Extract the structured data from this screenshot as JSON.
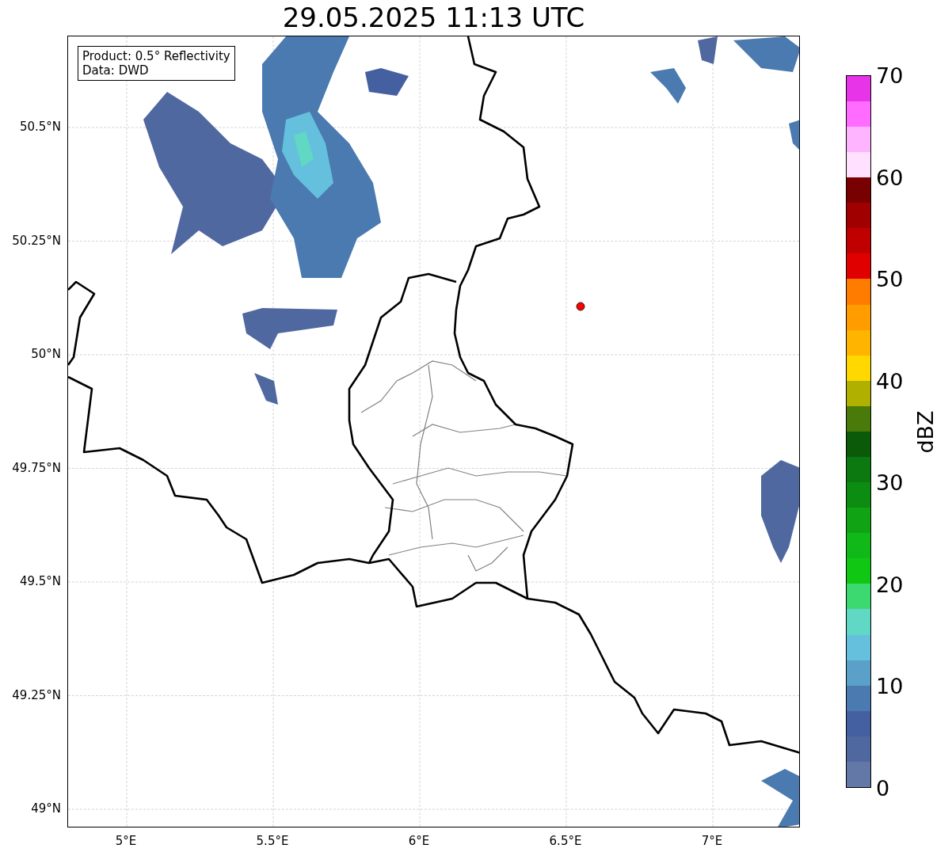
{
  "title": "29.05.2025 11:13 UTC",
  "legend": [
    "Product: 0.5° Reflectivity",
    "Data: DWD"
  ],
  "x_ticks": [
    "5°E",
    "5.5°E",
    "6°E",
    "6.5°E",
    "7°E"
  ],
  "y_ticks": [
    "50.5°N",
    "50.25°N",
    "50°N",
    "49.75°N",
    "49.5°N",
    "49.25°N",
    "49°N"
  ],
  "colorbar": {
    "label": "dBZ",
    "ticks": [
      "70",
      "60",
      "50",
      "40",
      "30",
      "20",
      "10",
      "0"
    ],
    "segments": [
      {
        "color": "#6478a8"
      },
      {
        "color": "#5068a0"
      },
      {
        "color": "#4460a0"
      },
      {
        "color": "#4a7ab0"
      },
      {
        "color": "#5aa0c8"
      },
      {
        "color": "#64c0dc"
      },
      {
        "color": "#60d8c4"
      },
      {
        "color": "#3cd870"
      },
      {
        "color": "#10c814"
      },
      {
        "color": "#10b818"
      },
      {
        "color": "#10a414"
      },
      {
        "color": "#0c8c10"
      },
      {
        "color": "#0c7810"
      },
      {
        "color": "#0a5a0a"
      },
      {
        "color": "#4a7a0a"
      },
      {
        "color": "#b0b000"
      },
      {
        "color": "#ffd800"
      },
      {
        "color": "#ffb400"
      },
      {
        "color": "#ff9c00"
      },
      {
        "color": "#ff7c00"
      },
      {
        "color": "#e00000"
      },
      {
        "color": "#c00000"
      },
      {
        "color": "#a00000"
      },
      {
        "color": "#780000"
      },
      {
        "color": "#ffe0ff"
      },
      {
        "color": "#ffb4ff"
      },
      {
        "color": "#ff6cff"
      },
      {
        "color": "#e834e8"
      }
    ]
  }
}
